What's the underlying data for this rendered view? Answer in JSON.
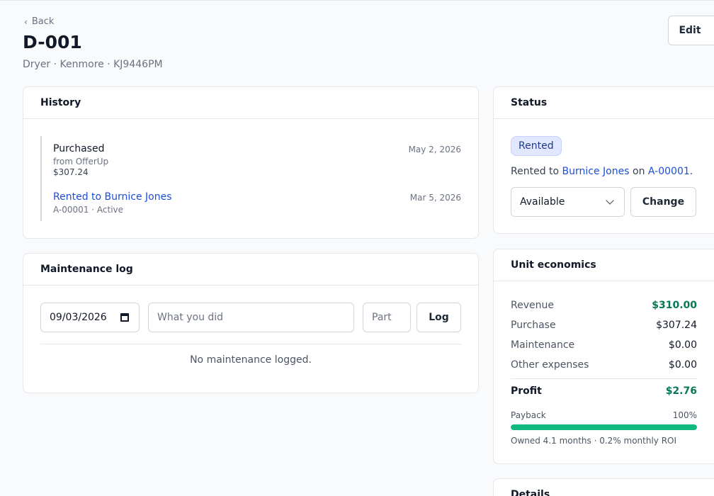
{
  "header": {
    "back_label": "Back",
    "title": "D-001",
    "subtitle": "Dryer · Kenmore · KJ9446PM",
    "edit_label": "Edit"
  },
  "history": {
    "heading": "History",
    "items": [
      {
        "title": "Purchased",
        "sub": "from OfferUp",
        "sub2": "$307.24",
        "date": "May 2, 2026"
      },
      {
        "title": "Rented to Burnice Jones",
        "sub": "A-00001 · Active",
        "date": "Mar 5, 2026"
      }
    ]
  },
  "maintenance": {
    "heading": "Maintenance log",
    "date_value": "09/03/2026",
    "description_placeholder": "What you did",
    "part_placeholder": "Part",
    "log_label": "Log",
    "empty_text": "No maintenance logged."
  },
  "status": {
    "heading": "Status",
    "badge": "Rented",
    "rented_prefix": "Rented to",
    "renter": "Burnice Jones",
    "on_word": "on",
    "agreement": "A-00001",
    "period": ".",
    "select_value": "Available",
    "change_label": "Change"
  },
  "economics": {
    "heading": "Unit economics",
    "rows": [
      {
        "label": "Revenue",
        "value": "$310.00"
      },
      {
        "label": "Purchase",
        "value": "$307.24"
      },
      {
        "label": "Maintenance",
        "value": "$0.00"
      },
      {
        "label": "Other expenses",
        "value": "$0.00"
      }
    ],
    "profit_label": "Profit",
    "profit_value": "$2.76",
    "payback_label": "Payback",
    "payback_value": "100%",
    "payback_fraction": 1.0,
    "owned_text": "Owned 4.1 months · 0.2% monthly ROI"
  },
  "details": {
    "heading": "Details"
  },
  "colors": {
    "accent": "#1d4ed8",
    "positive": "#047857",
    "progress": "#10b981",
    "badge_bg": "#e0e7ff"
  }
}
